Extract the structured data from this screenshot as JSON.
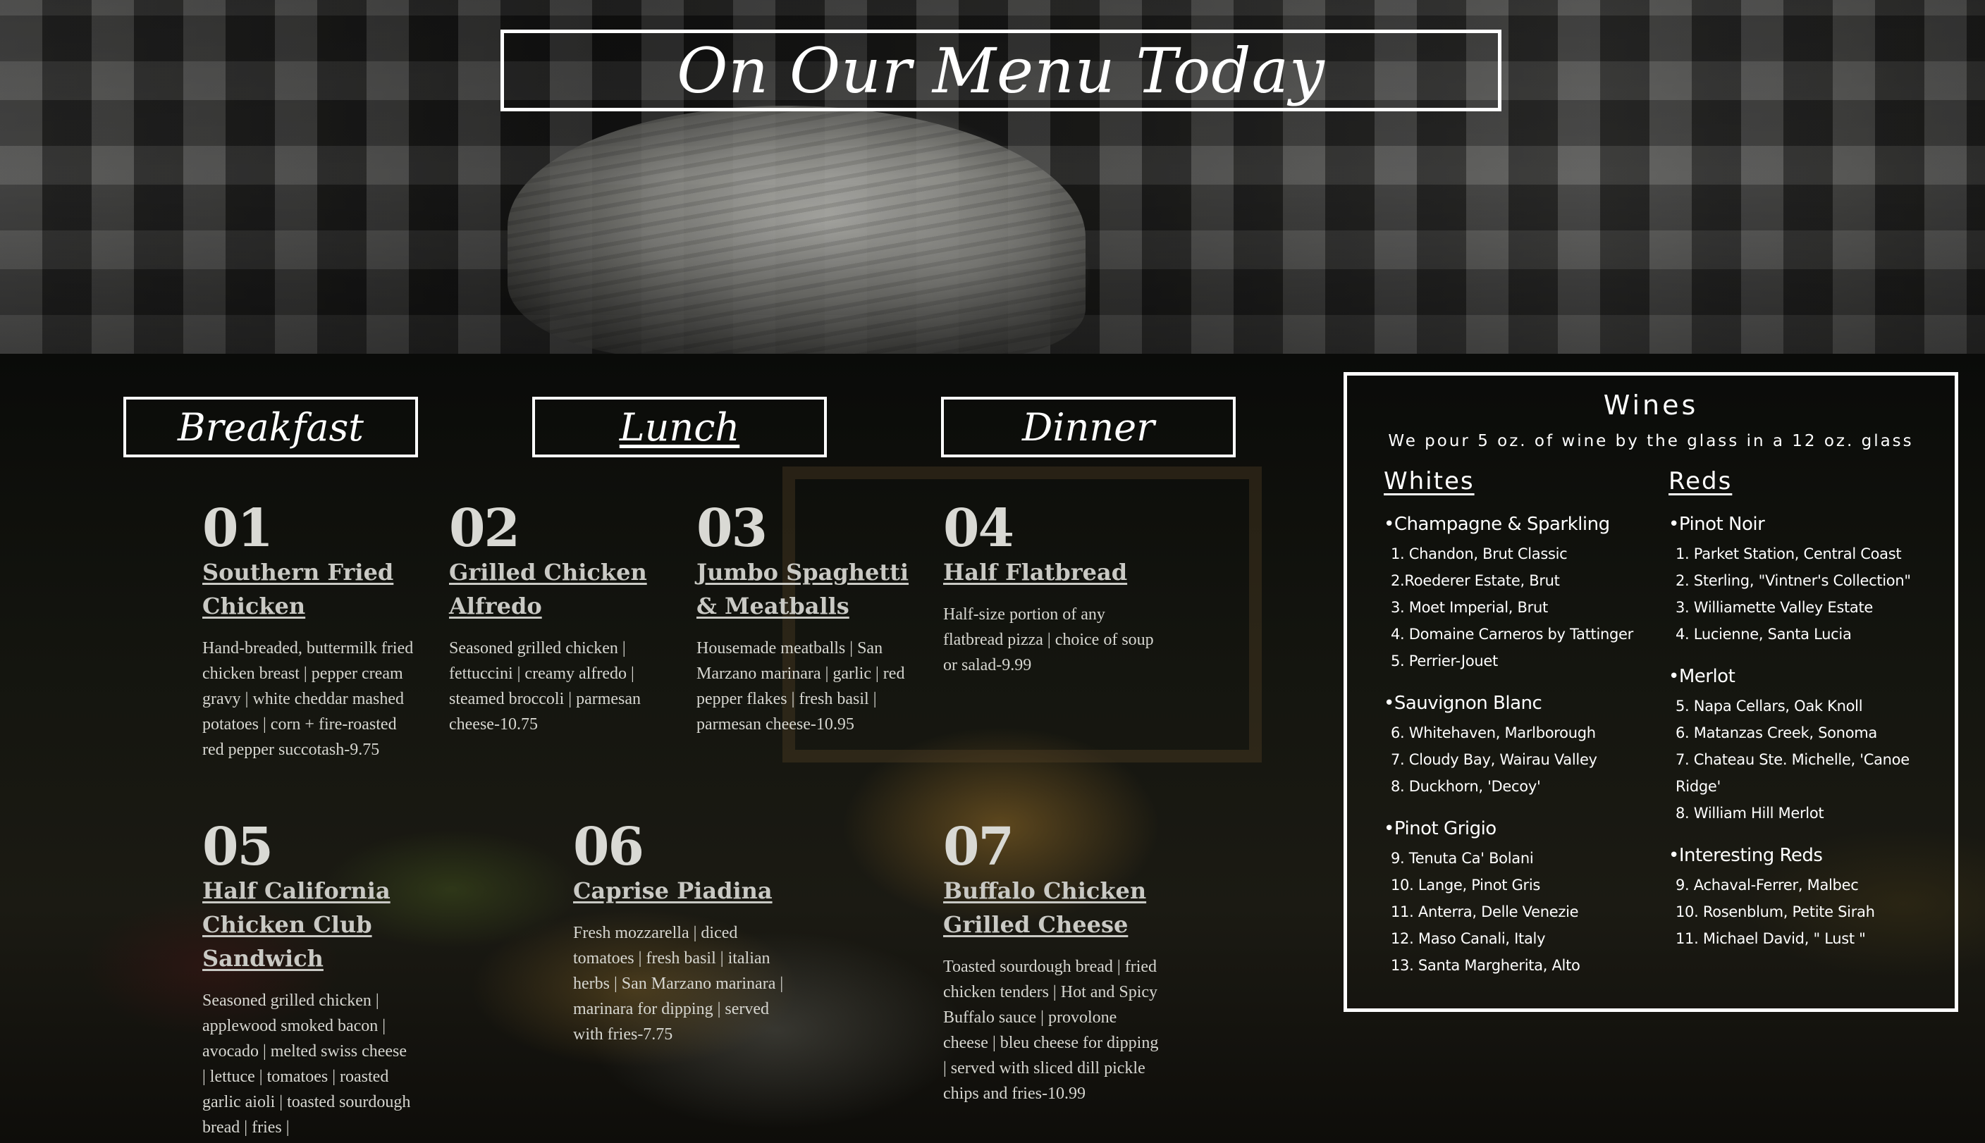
{
  "header": {
    "title": "On Our Menu Today"
  },
  "tabs": [
    {
      "label": "Breakfast",
      "active": false
    },
    {
      "label": "Lunch",
      "active": true
    },
    {
      "label": "Dinner",
      "active": false
    }
  ],
  "menu": [
    {
      "num": "01",
      "name": "Southern Fried Chicken",
      "desc": "Hand-breaded, buttermilk fried chicken breast | pepper cream gravy | white cheddar mashed potatoes | corn + fire-roasted red pepper succotash-9.75"
    },
    {
      "num": "02",
      "name": "Grilled Chicken Alfredo",
      "desc": "Seasoned grilled chicken | fettuccini | creamy alfredo | steamed broccoli | parmesan cheese-10.75"
    },
    {
      "num": "03",
      "name": "Jumbo Spaghetti & Meatballs",
      "desc": "Housemade meatballs | San Marzano marinara | garlic | red pepper flakes | fresh basil | parmesan cheese-10.95"
    },
    {
      "num": "04",
      "name": "Half Flatbread",
      "desc": "Half-size portion of any flatbread pizza | choice of soup or salad-9.99"
    },
    {
      "num": "05",
      "name": "Half California Chicken Club Sandwich",
      "desc": "Seasoned grilled chicken | applewood smoked bacon | avocado | melted swiss cheese | lettuce | tomatoes | roasted garlic aioli | toasted sourdough bread | fries |"
    },
    {
      "num": "06",
      "name": "Caprise Piadina",
      "desc": "Fresh mozzarella | diced tomatoes | fresh basil | italian herbs | San Marzano marinara | marinara for dipping | served with fries-7.75"
    },
    {
      "num": "07",
      "name": "Buffalo Chicken Grilled Cheese",
      "desc": "Toasted sourdough bread | fried chicken tenders | Hot and Spicy Buffalo sauce | provolone cheese | bleu cheese for dipping | served with sliced dill pickle chips and fries-10.99"
    }
  ],
  "wines": {
    "title": "Wines",
    "note": "We pour 5 oz. of wine by the glass in a 12 oz. glass",
    "whites": {
      "heading": "Whites",
      "groups": [
        {
          "title": "Champagne & Sparkling",
          "items": [
            "1. Chandon, Brut Classic",
            "2.Roederer Estate, Brut",
            "3. Moet Imperial, Brut",
            "4. Domaine Carneros by Tattinger",
            "5. Perrier-Jouet"
          ]
        },
        {
          "title": "Sauvignon Blanc",
          "items": [
            "6. Whitehaven, Marlborough",
            "7. Cloudy Bay, Wairau Valley",
            "8. Duckhorn, 'Decoy'"
          ]
        },
        {
          "title": "Pinot Grigio",
          "items": [
            "9. Tenuta Ca' Bolani",
            "10. Lange, Pinot Gris",
            "11. Anterra, Delle Venezie",
            "12. Maso Canali, Italy",
            "13. Santa Margherita, Alto"
          ]
        }
      ]
    },
    "reds": {
      "heading": "Reds",
      "groups": [
        {
          "title": "Pinot Noir",
          "items": [
            "1. Parket Station, Central Coast",
            "2. Sterling, \"Vintner's Collection\"",
            "3. Williamette Valley Estate",
            "4. Lucienne, Santa Lucia"
          ]
        },
        {
          "title": "Merlot",
          "items": [
            "5. Napa Cellars, Oak Knoll",
            "6. Matanzas Creek, Sonoma",
            "7. Chateau Ste. Michelle, 'Canoe Ridge'",
            "8. William Hill Merlot"
          ]
        },
        {
          "title": "Interesting Reds",
          "items": [
            "9. Achaval-Ferrer, Malbec",
            "10. Rosenblum, Petite Sirah",
            "11. Michael David, \" Lust \""
          ]
        }
      ]
    }
  }
}
